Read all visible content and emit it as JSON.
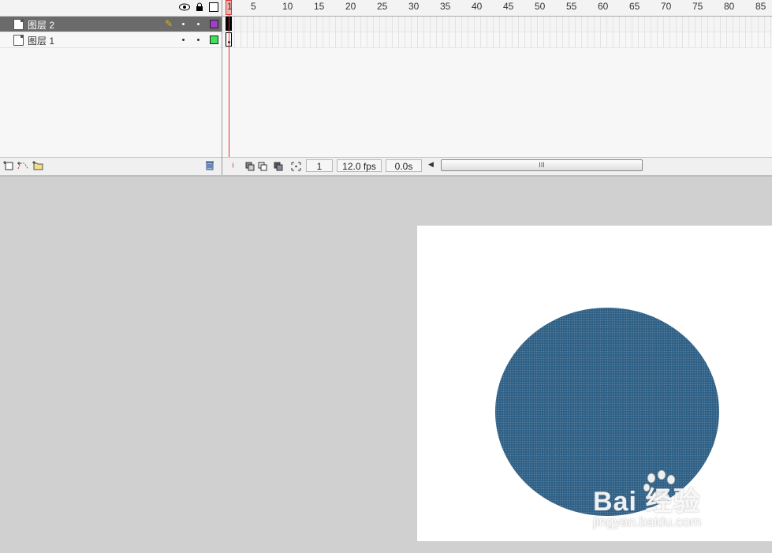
{
  "layers": {
    "header_icons": [
      "eye-icon",
      "lock-icon",
      "outline-icon"
    ],
    "rows": [
      {
        "name": "图层 2",
        "selected": true,
        "color": "#9c3fc4",
        "pencil_icon": "pencil-icon"
      },
      {
        "name": "图层 1",
        "selected": false,
        "color": "#3fe05a"
      }
    ],
    "footer_icons": [
      "insert-layer-icon",
      "add-motion-guide-icon",
      "insert-folder-icon",
      "delete-layer-icon"
    ]
  },
  "ruler": {
    "labels": [
      "1",
      "5",
      "10",
      "15",
      "20",
      "25",
      "30",
      "35",
      "40",
      "45",
      "50",
      "55",
      "60",
      "65",
      "70",
      "75",
      "80",
      "85"
    ]
  },
  "status": {
    "current_frame": "1",
    "frame_rate": "12.0 fps",
    "elapsed_time": "0.0s",
    "scroll_thumb": "III"
  },
  "stage": {
    "circle_color": "#2f6086",
    "background_color": "#ffffff"
  },
  "watermark": {
    "logo": "Bai 经验",
    "url": "jingyan.baidu.com"
  }
}
